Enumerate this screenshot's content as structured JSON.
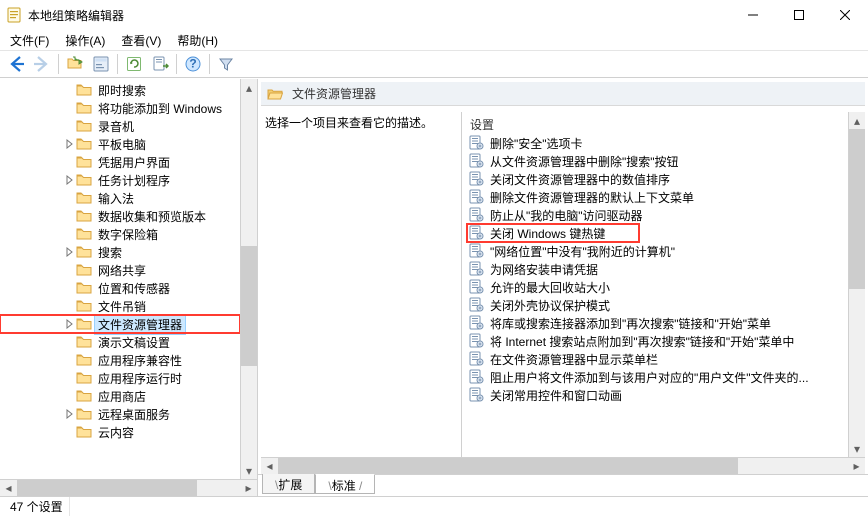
{
  "window": {
    "title": "本地组策略编辑器"
  },
  "menu": {
    "file": "文件(F)",
    "action": "操作(A)",
    "view": "查看(V)",
    "help": "帮助(H)"
  },
  "tree": {
    "items": [
      {
        "indent": 62,
        "expander": "none",
        "label": "即时搜索"
      },
      {
        "indent": 62,
        "expander": "none",
        "label": "将功能添加到 Windows"
      },
      {
        "indent": 62,
        "expander": "none",
        "label": "录音机"
      },
      {
        "indent": 62,
        "expander": "closed",
        "label": "平板电脑"
      },
      {
        "indent": 62,
        "expander": "none",
        "label": "凭据用户界面"
      },
      {
        "indent": 62,
        "expander": "closed",
        "label": "任务计划程序"
      },
      {
        "indent": 62,
        "expander": "none",
        "label": "输入法"
      },
      {
        "indent": 62,
        "expander": "none",
        "label": "数据收集和预览版本"
      },
      {
        "indent": 62,
        "expander": "none",
        "label": "数字保险箱"
      },
      {
        "indent": 62,
        "expander": "closed",
        "label": "搜索"
      },
      {
        "indent": 62,
        "expander": "none",
        "label": "网络共享"
      },
      {
        "indent": 62,
        "expander": "none",
        "label": "位置和传感器"
      },
      {
        "indent": 62,
        "expander": "none",
        "label": "文件吊销"
      },
      {
        "indent": 62,
        "expander": "closed",
        "label": "文件资源管理器",
        "selected": true,
        "boxed": true
      },
      {
        "indent": 62,
        "expander": "none",
        "label": "演示文稿设置"
      },
      {
        "indent": 62,
        "expander": "none",
        "label": "应用程序兼容性"
      },
      {
        "indent": 62,
        "expander": "none",
        "label": "应用程序运行时"
      },
      {
        "indent": 62,
        "expander": "none",
        "label": "应用商店"
      },
      {
        "indent": 62,
        "expander": "closed",
        "label": "远程桌面服务"
      },
      {
        "indent": 62,
        "expander": "none",
        "label": "云内容"
      }
    ]
  },
  "right": {
    "header": "文件资源管理器",
    "description_prompt": "选择一个项目来查看它的描述。",
    "settings_header": "设置",
    "settings": [
      {
        "label": "删除\"安全\"选项卡"
      },
      {
        "label": "从文件资源管理器中删除\"搜索\"按钮"
      },
      {
        "label": "关闭文件资源管理器中的数值排序"
      },
      {
        "label": "删除文件资源管理器的默认上下文菜单"
      },
      {
        "label": "防止从\"我的电脑\"访问驱动器"
      },
      {
        "label": "关闭 Windows 键热键",
        "boxed": true
      },
      {
        "label": "\"网络位置\"中没有\"我附近的计算机\""
      },
      {
        "label": "为网络安装申请凭据"
      },
      {
        "label": "允许的最大回收站大小"
      },
      {
        "label": "关闭外壳协议保护模式"
      },
      {
        "label": "将库或搜索连接器添加到\"再次搜索\"链接和\"开始\"菜单"
      },
      {
        "label": "将 Internet 搜索站点附加到\"再次搜索\"链接和\"开始\"菜单中"
      },
      {
        "label": "在文件资源管理器中显示菜单栏"
      },
      {
        "label": "阻止用户将文件添加到与该用户对应的\"用户文件\"文件夹的..."
      },
      {
        "label": "关闭常用控件和窗口动画"
      }
    ],
    "tabs": {
      "extended": "扩展",
      "standard": "标准"
    }
  },
  "status": {
    "text": "47 个设置"
  }
}
